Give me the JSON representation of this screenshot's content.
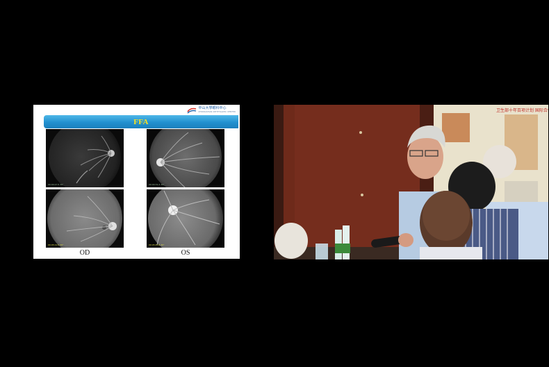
{
  "slide": {
    "title": "FFA",
    "labels": {
      "od": "OD",
      "os": "OS"
    },
    "logo": {
      "name": "中山大學",
      "dept": "眼科中心",
      "sub": "ZHONGSHAN OPHTHALMIC CENTER"
    },
    "colors": {
      "title_bar": "#2290cf",
      "title_text": "#ffe21c"
    }
  },
  "video": {
    "poster_text": "卫生部十年百项计划 国际合作全国推广"
  }
}
